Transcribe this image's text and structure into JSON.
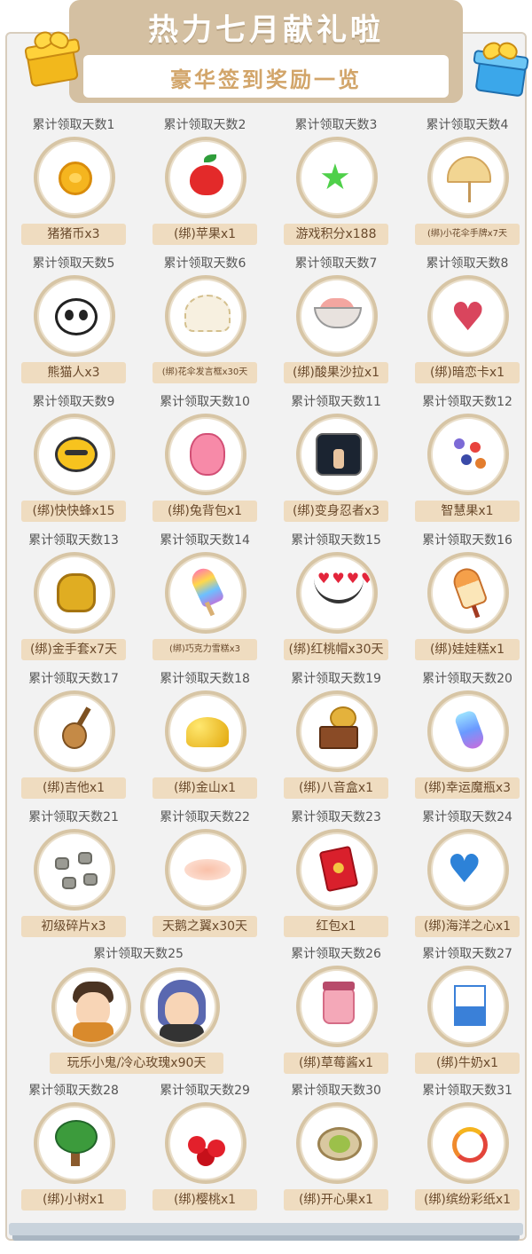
{
  "header": {
    "title": "热力七月献礼啦",
    "subtitle": "豪华签到奖励一览"
  },
  "colors": {
    "banner": "#d4c0a2",
    "subtitle": "#d2a56a",
    "label_bg": "#efdcc0",
    "ring": "#d7c5a5"
  },
  "rewards": [
    {
      "day": "累计领取天数1",
      "item": "猪猪币x3",
      "icon": "pig-coin-icon"
    },
    {
      "day": "累计领取天数2",
      "item": "(绑)苹果x1",
      "icon": "apple-icon"
    },
    {
      "day": "累计领取天数3",
      "item": "游戏积分x188",
      "icon": "star-icon"
    },
    {
      "day": "累计领取天数4",
      "item": "(绑)小花伞手牌x7天",
      "icon": "flower-umbrella-icon"
    },
    {
      "day": "累计领取天数5",
      "item": "熊猫人x3",
      "icon": "panda-icon"
    },
    {
      "day": "累计领取天数6",
      "item": "(绑)花伞发言框x30天",
      "icon": "lace-umbrella-icon"
    },
    {
      "day": "累计领取天数7",
      "item": "(绑)酸果沙拉x1",
      "icon": "fruit-salad-icon"
    },
    {
      "day": "累计领取天数8",
      "item": "(绑)暗恋卡x1",
      "icon": "heart-icon"
    },
    {
      "day": "累计领取天数9",
      "item": "(绑)快快蜂x15",
      "icon": "bee-icon"
    },
    {
      "day": "累计领取天数10",
      "item": "(绑)兔背包x1",
      "icon": "bunny-backpack-icon"
    },
    {
      "day": "累计领取天数11",
      "item": "(绑)变身忍者x3",
      "icon": "ninja-icon"
    },
    {
      "day": "累计领取天数12",
      "item": "智慧果x1",
      "icon": "wisdom-berry-icon"
    },
    {
      "day": "累计领取天数13",
      "item": "(绑)金手套x7天",
      "icon": "gold-glove-icon"
    },
    {
      "day": "累计领取天数14",
      "item": "(绑)巧克力雪糕x3",
      "icon": "ice-cream-icon"
    },
    {
      "day": "累计领取天数15",
      "item": "(绑)红桃帽x30天",
      "icon": "heart-crown-icon"
    },
    {
      "day": "累计领取天数16",
      "item": "(绑)娃娃糕x1",
      "icon": "ice-bar-icon"
    },
    {
      "day": "累计领取天数17",
      "item": "(绑)吉他x1",
      "icon": "guitar-icon"
    },
    {
      "day": "累计领取天数18",
      "item": "(绑)金山x1",
      "icon": "gold-pile-icon"
    },
    {
      "day": "累计领取天数19",
      "item": "(绑)八音盒x1",
      "icon": "music-box-icon"
    },
    {
      "day": "累计领取天数20",
      "item": "(绑)幸运魔瓶x3",
      "icon": "magic-bottle-icon"
    },
    {
      "day": "累计领取天数21",
      "item": "初级碎片x3",
      "icon": "fragments-icon"
    },
    {
      "day": "累计领取天数22",
      "item": "天鹅之翼x30天",
      "icon": "swan-wing-icon"
    },
    {
      "day": "累计领取天数23",
      "item": "红包x1",
      "icon": "red-envelope-icon"
    },
    {
      "day": "累计领取天数24",
      "item": "(绑)海洋之心x1",
      "icon": "ocean-heart-icon"
    },
    {
      "day": "累计领取天数25",
      "item": "玩乐小鬼/冷心玫瑰x90天",
      "icon": "avatar-pair-icon"
    },
    {
      "day": "累计领取天数26",
      "item": "(绑)草莓酱x1",
      "icon": "strawberry-jam-icon"
    },
    {
      "day": "累计领取天数27",
      "item": "(绑)牛奶x1",
      "icon": "milk-icon"
    },
    {
      "day": "累计领取天数28",
      "item": "(绑)小树x1",
      "icon": "tree-icon"
    },
    {
      "day": "累计领取天数29",
      "item": "(绑)樱桃x1",
      "icon": "cherry-icon"
    },
    {
      "day": "累计领取天数30",
      "item": "(绑)开心果x1",
      "icon": "pistachio-icon"
    },
    {
      "day": "累计领取天数31",
      "item": "(绑)缤纷彩纸x1",
      "icon": "confetti-icon"
    }
  ]
}
